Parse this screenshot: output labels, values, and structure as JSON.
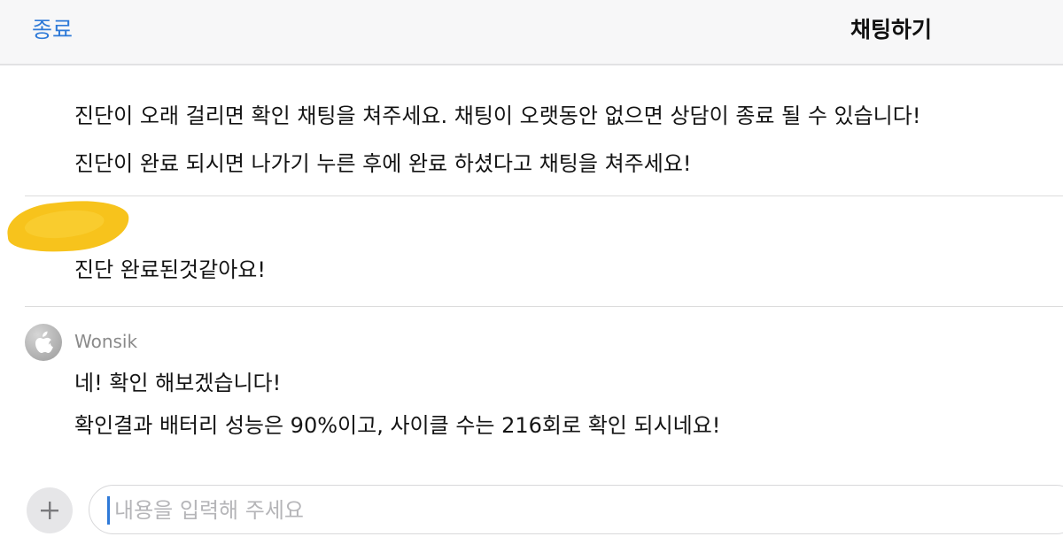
{
  "header": {
    "close_label": "종료",
    "title": "채팅하기"
  },
  "messages": {
    "system": [
      "진단이 오래 걸리면 확인 채팅을 쳐주세요. 채팅이 오랫동안 없으면 상담이 종료 될 수 있습니다!",
      "진단이 완료 되시면 나가기 누른 후에 완료 하셨다고 채팅을 쳐주세요!"
    ],
    "user": "진단 완료된것같아요!",
    "agent": {
      "name": "Wonsik",
      "lines": [
        "네! 확인 해보겠습니다!",
        "확인결과 배터리 성능은 90%이고, 사이클 수는 216회로 확인 되시네요!"
      ]
    }
  },
  "composer": {
    "placeholder": "내용을 입력해 주세요",
    "value": ""
  },
  "icons": {
    "avatar": "apple-logo-icon",
    "add": "plus-icon"
  },
  "colors": {
    "accent": "#2f7ad8",
    "redaction": "#f7c31c"
  }
}
